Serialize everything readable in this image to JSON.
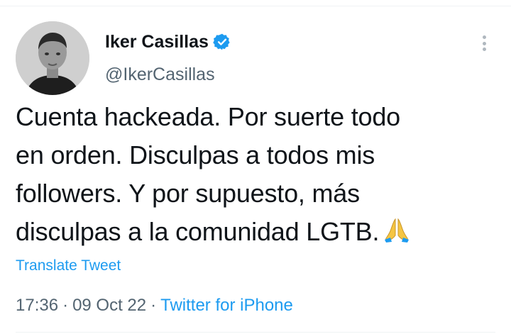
{
  "tweet": {
    "author": {
      "display_name": "Iker Casillas",
      "handle": "@IkerCasillas",
      "verified": true,
      "avatar_icon": "profile-photo"
    },
    "text_lines": [
      "Cuenta hackeada. Por suerte todo",
      "en orden. Disculpas a todos mis",
      "followers. Y por supuesto, más",
      "disculpas a la comunidad LGTB."
    ],
    "emoji": "🙏",
    "translate_label": "Translate Tweet",
    "time": "17:36",
    "date": "09 Oct 22",
    "separator": "·",
    "source": "Twitter for iPhone"
  },
  "colors": {
    "link": "#1d9bf0",
    "secondary_text": "#536471",
    "primary_text": "#0f1419",
    "verified_badge": "#1d9bf0"
  }
}
